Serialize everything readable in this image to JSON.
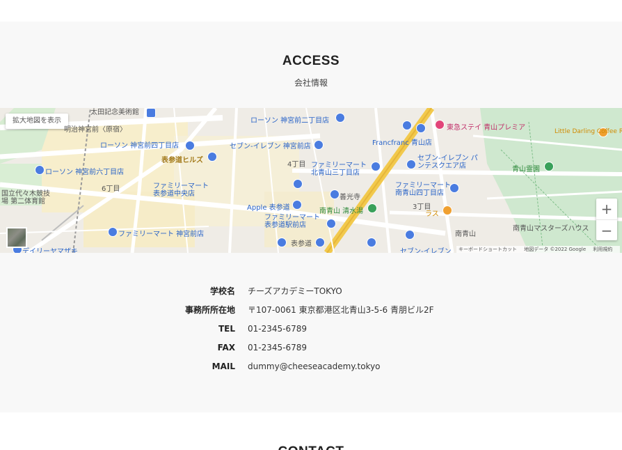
{
  "access": {
    "title": "ACCESS",
    "subtitle": "会社情報"
  },
  "map": {
    "expand_label": "拡大地図を表示",
    "zoom_in": "+",
    "zoom_out": "−",
    "google_logo": "Google",
    "footer": {
      "shortcuts": "キーボードショートカット",
      "data": "地図データ ©2022 Google",
      "terms": "利用規約"
    },
    "labels": [
      "太田記念美術館",
      "ローソン 神宮前二丁目店",
      "東急ステイ 青山プレミア",
      "Little Darling Coffee Roasters | リトル・",
      "明治神宮前〈原宿〉",
      "ローソン 神宮前四丁目店",
      "セブン-イレブン 神宮前店",
      "Francfranc 青山店",
      "表参道ヒルズ",
      "4丁目",
      "ファミリーマート 北青山三丁目店",
      "セブン-イレブン パンテスクエア店",
      "青山霊園",
      "ローソン 神宮前六丁目店",
      "6丁目",
      "善光寺",
      "ファミリーマート 表参道中央店",
      "ファミリーマート 南青山四丁目店",
      "国立代々木競技場 第二体育館",
      "Apple 表参道",
      "南青山 清水湯",
      "3丁目",
      "ラス",
      "ファミリーマート 表参道駅前店",
      "ファミリーマート 神宮前店",
      "南青山",
      "南青山マスターズハウス",
      "デイリーヤマザキ",
      "表参道",
      "セブン-イレブン"
    ]
  },
  "info": {
    "rows": [
      {
        "label": "学校名",
        "value": "チーズアカデミーTOKYO"
      },
      {
        "label": "事務所所在地",
        "value": "〒107-0061 東京都港区北青山3-5-6 青朋ビル2F"
      },
      {
        "label": "TEL",
        "value": "01-2345-6789"
      },
      {
        "label": "FAX",
        "value": "01-2345-6789"
      },
      {
        "label": "MAIL",
        "value": "dummy@cheeseacademy.tokyo"
      }
    ]
  },
  "contact": {
    "title": "CONTACT"
  }
}
